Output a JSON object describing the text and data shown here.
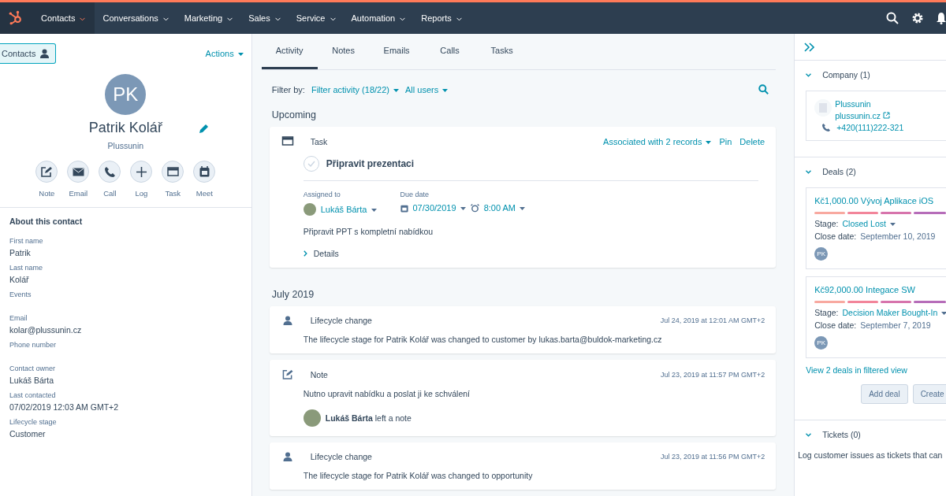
{
  "nav": {
    "items": [
      {
        "label": "Contacts",
        "selected": true
      },
      {
        "label": "Conversations",
        "selected": false
      },
      {
        "label": "Marketing",
        "selected": false
      },
      {
        "label": "Sales",
        "selected": false
      },
      {
        "label": "Service",
        "selected": false
      },
      {
        "label": "Automation",
        "selected": false
      },
      {
        "label": "Reports",
        "selected": false
      }
    ]
  },
  "contact": {
    "back_label": "Contacts",
    "actions": "Actions",
    "initials": "PK",
    "name": "Patrik Kolář",
    "company": "Plussunin",
    "quick_actions": [
      {
        "kind": "note",
        "label": "Note"
      },
      {
        "kind": "email",
        "label": "Email"
      },
      {
        "kind": "call",
        "label": "Call"
      },
      {
        "kind": "log",
        "label": "Log"
      },
      {
        "kind": "task",
        "label": "Task"
      },
      {
        "kind": "meet",
        "label": "Meet"
      }
    ],
    "about_title": "About this contact",
    "fields": [
      {
        "label": "First name",
        "value": "Patrik"
      },
      {
        "label": "Last name",
        "value": "Kolář"
      },
      {
        "label": "Events"
      },
      {
        "label": "Email",
        "value": "kolar@plussunin.cz"
      },
      {
        "label": "Phone number"
      },
      {
        "label": "Contact owner",
        "value": "Lukáš Bárta"
      },
      {
        "label": "Last contacted",
        "value": "07/02/2019 12:03 AM GMT+2"
      },
      {
        "label": "Lifecycle stage",
        "value": "Customer"
      }
    ]
  },
  "tabs": [
    {
      "label": "Activity",
      "selected": true
    },
    {
      "label": "Notes",
      "selected": false
    },
    {
      "label": "Emails",
      "selected": false
    },
    {
      "label": "Calls",
      "selected": false
    },
    {
      "label": "Tasks",
      "selected": false
    }
  ],
  "filter": {
    "label": "Filter by:",
    "activity": "Filter activity (18/22)",
    "users": "All users"
  },
  "upcoming": {
    "heading": "Upcoming",
    "task": {
      "type": "Task",
      "associated": "Associated with 2 records",
      "pin": "Pin",
      "delete": "Delete",
      "title": "Připravit prezentaci",
      "completed": false,
      "assigned_label": "Assigned to",
      "assignee": "Lukáš Bárta",
      "due_label": "Due date",
      "due_date": "07/30/2019",
      "due_time": "8:00 AM",
      "description": "Připravit PPT s kompletní nabídkou",
      "details": "Details"
    }
  },
  "timeline": {
    "heading": "July 2019",
    "events": [
      {
        "kind": "lifecycle",
        "title": "Lifecycle change",
        "time": "Jul 24, 2019 at 12:01 AM GMT+2",
        "text": "The lifecycle stage for Patrik Kolář was changed to customer by lukas.barta@buldok-marketing.cz"
      },
      {
        "kind": "note",
        "title": "Note",
        "time": "Jul 23, 2019 at 11:57 PM GMT+2",
        "text": "Nutno upravit nabídku a poslat ji ke schválení",
        "author": "Lukáš Bárta",
        "author_suffix": "left a note"
      },
      {
        "kind": "lifecycle",
        "title": "Lifecycle change",
        "time": "Jul 23, 2019 at 11:56 PM GMT+2",
        "text": "The lifecycle stage for Patrik Kolář was changed to opportunity"
      }
    ]
  },
  "sidebar": {
    "company": {
      "heading": "Company (1)",
      "expanded": true,
      "name": "Plussunin",
      "domain": "plussunin.cz",
      "phone": "+420(111)222-321"
    },
    "deals": {
      "heading": "Deals (2)",
      "expanded": true,
      "items": [
        {
          "title": "Kč1,000.00 Vývoj Aplikace iOS",
          "stage_label": "Stage:",
          "stage": "Closed Lost",
          "close_label": "Close date:",
          "close_date": "September 10, 2019",
          "owner": "PK"
        },
        {
          "title": "Kč92,000.00 Integace SW",
          "stage_label": "Stage:",
          "stage": "Decision Maker Bought-In",
          "close_label": "Close date:",
          "close_date": "September 7, 2019",
          "owner": "PK"
        }
      ],
      "view_link": "View 2 deals in filtered view",
      "buttons": [
        "Add deal",
        "Create"
      ]
    },
    "tickets": {
      "heading": "Tickets (0)",
      "expanded": true,
      "text": "Log customer issues as tickets that can"
    }
  }
}
